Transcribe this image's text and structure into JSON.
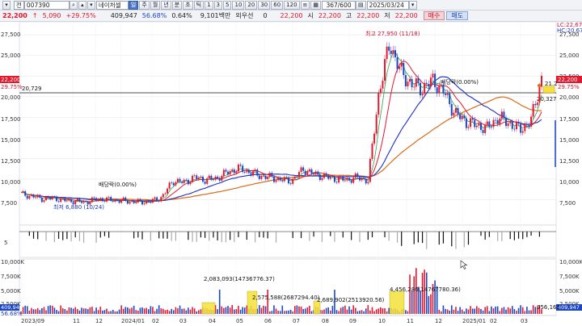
{
  "toolbar": {
    "market_label": "전",
    "stock_code": "007390",
    "stock_name": "네이처셀",
    "period_buttons": [
      "주",
      "월",
      "년",
      "분",
      "초",
      "틱"
    ],
    "interval_buttons": [
      "1",
      "3",
      "5",
      "10",
      "20",
      "30",
      "60",
      "120"
    ],
    "bar_count": "367/600",
    "date": "2025/03/24"
  },
  "quote": {
    "price": "22,200",
    "change": "5,090",
    "change_pct": "+29.75%",
    "volume": "409,947",
    "volume_ratio": "56.68%",
    "turnover_rate": "0.64%",
    "trading_value": "9,101백만",
    "ownership_label": "외우선",
    "ownership_value": "0",
    "open_price": "22,200",
    "open_label": "시",
    "open_value": "22,200",
    "high_label": "고",
    "high_value": "22,200",
    "low_label": "저",
    "low_value": "22,200",
    "buy_label": "매수",
    "sell_label": "매도"
  },
  "chart_labels": {
    "high_annotation": "최고 27,950 (11/18)",
    "low_annotation": "최저 6,880 (10/24)",
    "dividend_annotation": "배당락(0.00%)",
    "dividend_annotation2": "배당락(0.00%)",
    "hline_value": "20,729",
    "hline_right": "20,327",
    "right_price_tag": "22,200",
    "right_pct_tag": "29.75%",
    "left_price_tag": "22,200",
    "left_pct_tag": "29.75%",
    "lc_label": "LC:22,67",
    "hc_label": "HC:20,67",
    "ma_right": "21.2",
    "indicator_level": "5",
    "vol_label_1": "2,083,093(14736776.37)",
    "vol_label_2": "2,575,588(2687294.40)",
    "vol_label_3": "2,689,902(2513920.56)",
    "vol_label_4": "4,456,286(14767780.36)",
    "vol_left_tag": "409,947",
    "vol_left_pct": "56.68%",
    "vol_right_tag": "409,947",
    "vol_right_small": "956,163"
  },
  "chart_data": {
    "type": "candlestick",
    "price_axis": [
      "27,500",
      "25,000",
      "22,500",
      "20,000",
      "17,500",
      "15,000",
      "12,500",
      "10,000",
      "7,500"
    ],
    "volume_axis": [
      "10,000K",
      "7,500K",
      "5,000K",
      "2,500K"
    ],
    "x_ticks": [
      "2023/09",
      "11",
      "12",
      "2024/01",
      "02",
      "03",
      "04",
      "05",
      "06",
      "07",
      "08",
      "09",
      "10",
      "11",
      "12",
      "2025/01",
      "02",
      "03"
    ],
    "ylim": [
      5000,
      28500
    ],
    "series": [
      {
        "name": "close",
        "values": [
          8200,
          7900,
          7600,
          7700,
          7400,
          7300,
          7200,
          7600,
          7500,
          7400,
          7300,
          7200,
          7300,
          7800,
          9800,
          9600,
          10200,
          9900,
          10100,
          10800,
          11300,
          10900,
          10400,
          10200,
          9900,
          9800,
          11200,
          10600,
          10300,
          10000,
          9900,
          10200,
          9800,
          20500,
          26500,
          23000,
          21500,
          21000,
          22000,
          20500,
          18000,
          17000,
          16500,
          16200,
          17500,
          16800,
          16000,
          17000,
          22200
        ]
      }
    ],
    "colors": {
      "up": "#e2182e",
      "down": "#1c46c9",
      "ma5": "#e2182e",
      "ma20": "#1b2fbf",
      "ma60": "#2aa34a",
      "ma120": "#d86b16"
    }
  }
}
